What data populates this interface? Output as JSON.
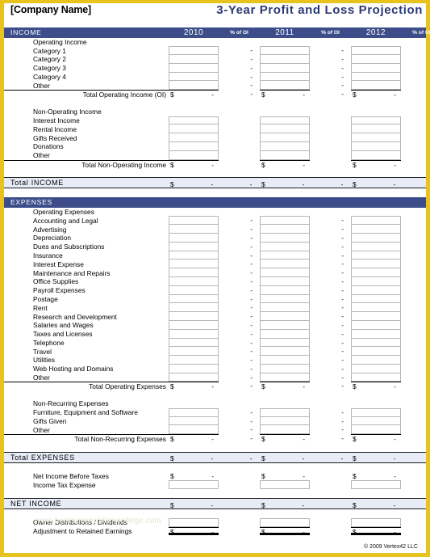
{
  "header": {
    "company": "[Company Name]",
    "title": "3-Year Profit and Loss Projection"
  },
  "columns": {
    "years": [
      "2010",
      "2011",
      "2012"
    ],
    "pct_label": "% of OI"
  },
  "income": {
    "section_label": "INCOME",
    "operating": {
      "group_label": "Operating Income",
      "rows": [
        "Category 1",
        "Category 2",
        "Category 3",
        "Category 4",
        "Other"
      ],
      "total_label": "Total Operating Income (OI)"
    },
    "non_operating": {
      "group_label": "Non-Operating Income",
      "rows": [
        "Interest Income",
        "Rental Income",
        "Gifts Received",
        "Donations",
        "Other"
      ],
      "total_label": "Total Non-Operating Income"
    },
    "total_label": "Total INCOME"
  },
  "expenses": {
    "section_label": "EXPENSES",
    "operating": {
      "group_label": "Operating Expenses",
      "rows": [
        "Accounting and Legal",
        "Advertising",
        "Depreciation",
        "Dues and Subscriptions",
        "Insurance",
        "Interest Expense",
        "Maintenance and Repairs",
        "Office Supplies",
        "Payroll Expenses",
        "Postage",
        "Rent",
        "Research and Development",
        "Salaries and Wages",
        "Taxes and Licenses",
        "Telephone",
        "Travel",
        "Utilities",
        "Web Hosting and Domains",
        "Other"
      ],
      "total_label": "Total Operating Expenses"
    },
    "non_recurring": {
      "group_label": "Non-Recurring Expenses",
      "rows": [
        "Furniture, Equipment and Software",
        "Gifts Given",
        "Other"
      ],
      "total_label": "Total Non-Recurring Expenses"
    },
    "total_label": "Total EXPENSES"
  },
  "bottom": {
    "net_income_before_taxes": "Net Income Before Taxes",
    "income_tax_expense": "Income Tax Expense",
    "net_income_label": "NET INCOME",
    "owner_distributions": "Owner Distributions / Dividends",
    "adjustment_retained": "Adjustment to Retained Earnings"
  },
  "values": {
    "currency_symbol": "$",
    "blank_value": "-",
    "pct_value": "-"
  },
  "watermark": "www.heritagechristiancollege.com",
  "footer": "© 2009 Vertex42 LLC",
  "colors": {
    "frame": "#e8c31d",
    "section_bar": "#3c4d8a",
    "total_bar": "#e7ecf7",
    "title_text": "#2c3a73"
  }
}
